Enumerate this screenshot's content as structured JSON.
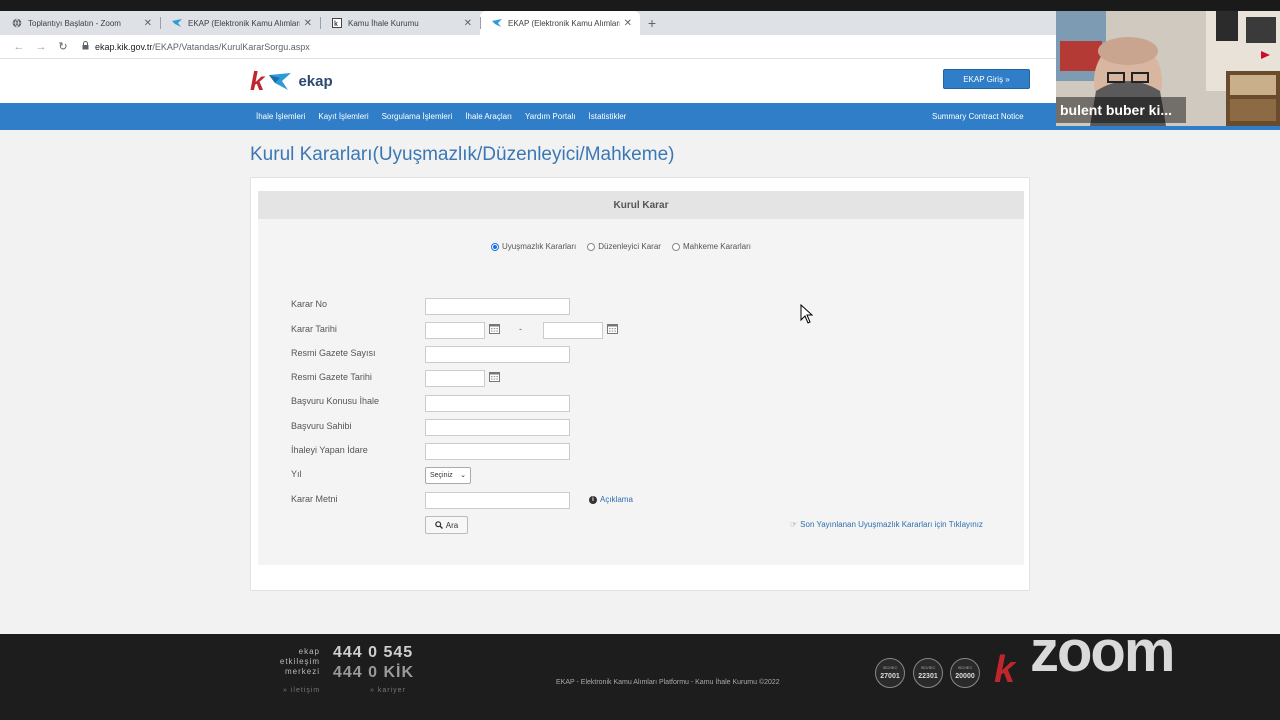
{
  "browser": {
    "tabs": [
      {
        "title": "Toplantıyı Başlatın - Zoom",
        "active": false
      },
      {
        "title": "EKAP (Elektronik Kamu Alımları P",
        "active": false
      },
      {
        "title": "Kamu İhale Kurumu",
        "active": false
      },
      {
        "title": "EKAP (Elektronik Kamu Alımları P",
        "active": true
      }
    ],
    "url_host": "ekap.kik.gov.tr",
    "url_path": "/EKAP/Vatandas/KurulKararSorgu.aspx"
  },
  "header": {
    "logo_letter": "k",
    "logo_word": "ekap",
    "login_button": "EKAP Giriş »"
  },
  "nav": {
    "items": [
      "İhale İşlemleri",
      "Kayıt İşlemleri",
      "Sorgulama İşlemleri",
      "İhale Araçları",
      "Yardım Portalı",
      "İstatistikler"
    ],
    "right_link": "Summary Contract Notice"
  },
  "page": {
    "title": "Kurul Kararları(Uyuşmazlık/Düzenleyici/Mahkeme)",
    "panel_title": "Kurul Karar",
    "radios": [
      {
        "label": "Uyuşmazlık Kararları",
        "checked": true
      },
      {
        "label": "Düzenleyici Karar",
        "checked": false
      },
      {
        "label": "Mahkeme Kararları",
        "checked": false
      }
    ],
    "fields": {
      "karar_no": "Karar No",
      "karar_tarihi": "Karar Tarihi",
      "resmi_gazete_sayisi": "Resmi Gazete Sayısı",
      "resmi_gazete_tarihi": "Resmi Gazete Tarihi",
      "basvuru_konusu": "Başvuru Konusu İhale",
      "basvuru_sahibi": "Başvuru Sahibi",
      "ihaleyi_yapan": "İhaleyi Yapan İdare",
      "yil": "Yıl",
      "karar_metni": "Karar Metni"
    },
    "date_separator": "-",
    "yil_selected": "Seçiniz",
    "aciklama": "Açıklama",
    "search_button": "Ara",
    "recent_link": "Son Yayınlanan Uyuşmazlık Kararları için Tıklayınız"
  },
  "footer": {
    "contact_line1": "ekap",
    "contact_line2": "etkileşim",
    "contact_line3": "merkezi",
    "phone1": "444 0 545",
    "phone2": "444 0 KİK",
    "link_iletisim": "» iletişim",
    "link_kariyer": "» kariyer",
    "copyright": "EKAP - Elektronik Kamu Alımları Platformu - Kamu İhale Kurumu ©2022",
    "certs": [
      {
        "std": "ISO/IEC",
        "num": "27001"
      },
      {
        "std": "ISO/IEC",
        "num": "22301"
      },
      {
        "std": "ISO/IEC",
        "num": "20000"
      }
    ]
  },
  "overlay": {
    "zoom_logo": "zoom",
    "webcam_name": "bulent buber ki..."
  },
  "colors": {
    "nav_blue": "#2f7ec7",
    "title_blue": "#3a78b5",
    "brand_red": "#c0272d",
    "footer_bg": "#1d1d1d"
  }
}
